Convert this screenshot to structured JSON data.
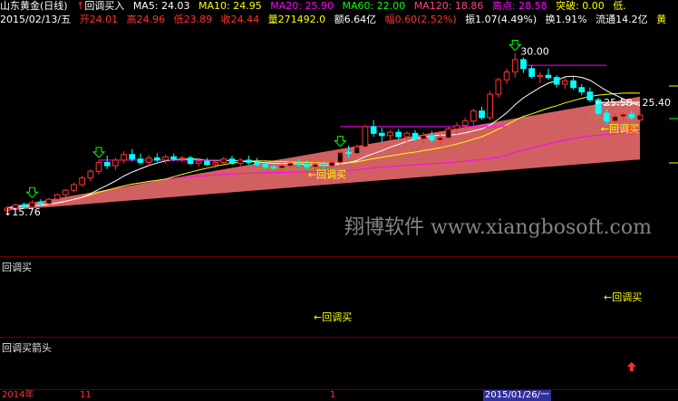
{
  "header": {
    "title": "山东黄金(日线)",
    "indicator": "回调买入",
    "ma5": "MA5: 24.03",
    "ma10": "MA10: 24.95",
    "ma20": "MA20: 25.90",
    "ma60": "MA60: 22.00",
    "ma120": "MA120: 18.86",
    "high_label": "高点: 28.58",
    "breakout_label": "突破: 0.00",
    "low_label": "低.",
    "date": "2015/02/13/五",
    "open": "开24.01",
    "high": "高24.96",
    "low": "低23.89",
    "close": "收24.44",
    "volume": "量271492.0",
    "amount": "额6.64亿",
    "change": "幅0.60(2.52%)",
    "amplitude": "振1.07(4.49%)",
    "turnover": "换1.91%",
    "float_cap": "流通14.2亿",
    "color_word": "黄"
  },
  "colors": {
    "up": "#ff3232",
    "down": "#00ffff",
    "ma5": "#ffffff",
    "ma10": "#ffff00",
    "ma20": "#ff00ff",
    "ma60": "#00ff00",
    "ma120": "#ff4080"
  },
  "watermark": "翔博软件 www.xiangbosoft.com",
  "annotations": {
    "peak_price": "30.00",
    "low_price": "15.76",
    "range_text": "25.58 - 25.40",
    "signal_label_1": "←回调买",
    "signal_label_2": "←回调买"
  },
  "pane2": {
    "label": "回调买",
    "signal_1": "←回调买",
    "signal_2": "←回调买"
  },
  "pane3": {
    "label": "回调买箭头"
  },
  "axis": {
    "t0": "2014年",
    "t1": "11",
    "t2": "1",
    "t3": "2015/01/26/一"
  },
  "chart_data": {
    "type": "candlestick",
    "candles": [
      {
        "o": 15.9,
        "h": 16.3,
        "l": 15.76,
        "c": 16.1
      },
      {
        "o": 16.1,
        "h": 16.5,
        "l": 15.9,
        "c": 16.4
      },
      {
        "o": 16.4,
        "h": 16.6,
        "l": 16.0,
        "c": 16.2
      },
      {
        "o": 16.2,
        "h": 16.8,
        "l": 16.0,
        "c": 16.6
      },
      {
        "o": 16.6,
        "h": 16.9,
        "l": 16.3,
        "c": 16.5
      },
      {
        "o": 16.5,
        "h": 17.0,
        "l": 16.4,
        "c": 16.9
      },
      {
        "o": 16.9,
        "h": 17.4,
        "l": 16.8,
        "c": 17.3
      },
      {
        "o": 17.3,
        "h": 17.8,
        "l": 17.1,
        "c": 17.7
      },
      {
        "o": 17.7,
        "h": 18.4,
        "l": 17.5,
        "c": 18.2
      },
      {
        "o": 18.2,
        "h": 19.0,
        "l": 18.0,
        "c": 18.8
      },
      {
        "o": 18.8,
        "h": 19.6,
        "l": 18.5,
        "c": 19.4
      },
      {
        "o": 19.4,
        "h": 20.4,
        "l": 19.1,
        "c": 20.2
      },
      {
        "o": 20.2,
        "h": 20.8,
        "l": 19.6,
        "c": 19.9
      },
      {
        "o": 19.9,
        "h": 20.6,
        "l": 19.5,
        "c": 20.4
      },
      {
        "o": 20.4,
        "h": 21.2,
        "l": 20.1,
        "c": 20.9
      },
      {
        "o": 20.9,
        "h": 21.4,
        "l": 20.3,
        "c": 20.5
      },
      {
        "o": 20.5,
        "h": 21.0,
        "l": 20.0,
        "c": 20.2
      },
      {
        "o": 20.2,
        "h": 20.9,
        "l": 19.9,
        "c": 20.6
      },
      {
        "o": 20.6,
        "h": 21.0,
        "l": 20.2,
        "c": 20.4
      },
      {
        "o": 20.4,
        "h": 20.9,
        "l": 20.1,
        "c": 20.7
      },
      {
        "o": 20.7,
        "h": 21.0,
        "l": 20.3,
        "c": 20.5
      },
      {
        "o": 20.5,
        "h": 20.8,
        "l": 20.2,
        "c": 20.6
      },
      {
        "o": 20.6,
        "h": 20.8,
        "l": 20.0,
        "c": 20.1
      },
      {
        "o": 20.1,
        "h": 20.5,
        "l": 19.8,
        "c": 20.3
      },
      {
        "o": 20.3,
        "h": 20.6,
        "l": 19.9,
        "c": 20.0
      },
      {
        "o": 20.0,
        "h": 20.4,
        "l": 19.7,
        "c": 20.2
      },
      {
        "o": 20.2,
        "h": 20.7,
        "l": 19.9,
        "c": 20.5
      },
      {
        "o": 20.5,
        "h": 20.8,
        "l": 20.0,
        "c": 20.1
      },
      {
        "o": 20.1,
        "h": 20.6,
        "l": 19.8,
        "c": 20.4
      },
      {
        "o": 20.4,
        "h": 20.8,
        "l": 20.0,
        "c": 20.2
      },
      {
        "o": 20.2,
        "h": 20.6,
        "l": 19.9,
        "c": 20.0
      },
      {
        "o": 20.0,
        "h": 20.4,
        "l": 19.6,
        "c": 19.8
      },
      {
        "o": 19.8,
        "h": 20.2,
        "l": 19.5,
        "c": 19.7
      },
      {
        "o": 19.7,
        "h": 20.1,
        "l": 19.4,
        "c": 19.9
      },
      {
        "o": 19.9,
        "h": 20.3,
        "l": 19.6,
        "c": 20.1
      },
      {
        "o": 20.1,
        "h": 20.5,
        "l": 19.8,
        "c": 20.0
      },
      {
        "o": 20.0,
        "h": 20.4,
        "l": 19.6,
        "c": 19.8
      },
      {
        "o": 19.8,
        "h": 20.2,
        "l": 19.5,
        "c": 20.0
      },
      {
        "o": 20.0,
        "h": 20.3,
        "l": 19.7,
        "c": 19.9
      },
      {
        "o": 19.9,
        "h": 20.4,
        "l": 19.7,
        "c": 20.2
      },
      {
        "o": 20.2,
        "h": 21.4,
        "l": 20.0,
        "c": 21.1
      },
      {
        "o": 21.1,
        "h": 21.7,
        "l": 20.6,
        "c": 21.0
      },
      {
        "o": 21.0,
        "h": 21.8,
        "l": 20.7,
        "c": 21.6
      },
      {
        "o": 21.6,
        "h": 23.6,
        "l": 21.4,
        "c": 23.4
      },
      {
        "o": 23.4,
        "h": 24.0,
        "l": 22.5,
        "c": 22.8
      },
      {
        "o": 22.8,
        "h": 23.3,
        "l": 22.0,
        "c": 22.6
      },
      {
        "o": 22.6,
        "h": 23.1,
        "l": 22.2,
        "c": 22.9
      },
      {
        "o": 22.9,
        "h": 23.2,
        "l": 22.3,
        "c": 22.5
      },
      {
        "o": 22.5,
        "h": 23.0,
        "l": 22.0,
        "c": 22.8
      },
      {
        "o": 22.8,
        "h": 23.1,
        "l": 22.1,
        "c": 22.3
      },
      {
        "o": 22.3,
        "h": 22.9,
        "l": 21.9,
        "c": 22.6
      },
      {
        "o": 22.6,
        "h": 23.0,
        "l": 22.0,
        "c": 22.2
      },
      {
        "o": 22.2,
        "h": 22.8,
        "l": 21.8,
        "c": 22.4
      },
      {
        "o": 22.4,
        "h": 23.4,
        "l": 22.2,
        "c": 23.2
      },
      {
        "o": 23.2,
        "h": 23.8,
        "l": 22.7,
        "c": 23.5
      },
      {
        "o": 23.5,
        "h": 24.2,
        "l": 23.0,
        "c": 23.9
      },
      {
        "o": 23.9,
        "h": 25.0,
        "l": 23.5,
        "c": 24.8
      },
      {
        "o": 24.8,
        "h": 25.2,
        "l": 24.0,
        "c": 24.2
      },
      {
        "o": 24.2,
        "h": 26.6,
        "l": 24.0,
        "c": 26.3
      },
      {
        "o": 26.3,
        "h": 27.8,
        "l": 26.0,
        "c": 27.6
      },
      {
        "o": 27.6,
        "h": 28.6,
        "l": 27.2,
        "c": 28.3
      },
      {
        "o": 28.3,
        "h": 30.0,
        "l": 27.8,
        "c": 29.4
      },
      {
        "o": 29.4,
        "h": 29.6,
        "l": 28.2,
        "c": 28.6
      },
      {
        "o": 28.6,
        "h": 28.9,
        "l": 27.7,
        "c": 27.9
      },
      {
        "o": 27.9,
        "h": 28.3,
        "l": 27.3,
        "c": 28.0
      },
      {
        "o": 28.0,
        "h": 28.6,
        "l": 27.6,
        "c": 27.8
      },
      {
        "o": 27.8,
        "h": 28.0,
        "l": 26.9,
        "c": 27.2
      },
      {
        "o": 27.2,
        "h": 27.8,
        "l": 26.8,
        "c": 27.5
      },
      {
        "o": 27.5,
        "h": 27.8,
        "l": 26.7,
        "c": 26.9
      },
      {
        "o": 26.9,
        "h": 27.2,
        "l": 26.2,
        "c": 26.5
      },
      {
        "o": 26.5,
        "h": 26.9,
        "l": 25.6,
        "c": 25.8
      },
      {
        "o": 25.8,
        "h": 26.0,
        "l": 24.4,
        "c": 24.6
      },
      {
        "o": 24.6,
        "h": 25.0,
        "l": 23.6,
        "c": 23.9
      },
      {
        "o": 23.9,
        "h": 24.6,
        "l": 23.6,
        "c": 24.3
      },
      {
        "o": 24.3,
        "h": 24.7,
        "l": 23.9,
        "c": 24.5
      },
      {
        "o": 24.5,
        "h": 24.8,
        "l": 24.0,
        "c": 24.2
      },
      {
        "o": 24.01,
        "h": 24.96,
        "l": 23.89,
        "c": 24.44
      }
    ],
    "ylim": [
      13.5,
      31.5
    ],
    "peak": 30.0,
    "trough": 15.76,
    "range_top": 25.58,
    "range_bottom": 25.4,
    "buy_signal_idx": [
      3,
      11,
      40,
      61
    ],
    "callback_buy_idx": [
      37,
      75
    ],
    "arrow_up_idx": [
      75
    ]
  }
}
